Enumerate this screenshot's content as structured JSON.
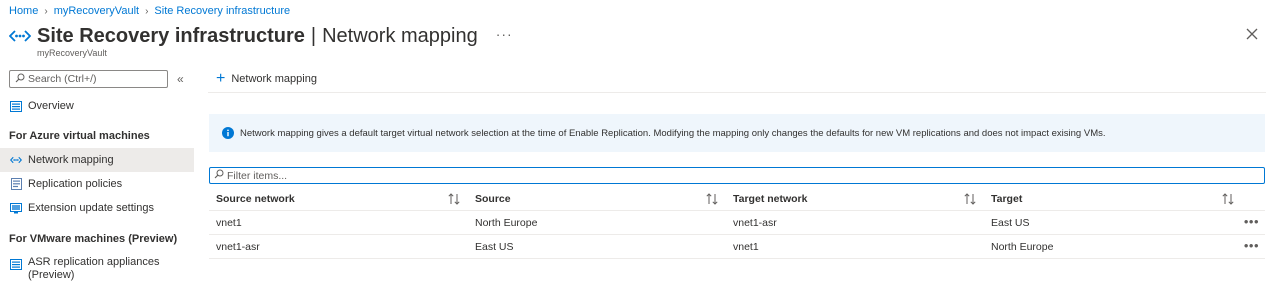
{
  "breadcrumb": {
    "items": [
      "Home",
      "myRecoveryVault",
      "Site Recovery infrastructure"
    ]
  },
  "header": {
    "title_main": "Site Recovery infrastructure",
    "title_separator": "|",
    "title_sub": "Network mapping",
    "more": "···",
    "resource": "myRecoveryVault"
  },
  "sidebar": {
    "search_placeholder": "Search (Ctrl+/)",
    "collapse": "«",
    "overview": "Overview",
    "section_azure": "For Azure virtual machines",
    "azure_items": [
      "Network mapping",
      "Replication policies",
      "Extension update settings"
    ],
    "section_vmware": "For VMware machines (Preview)",
    "vmware_items": [
      {
        "line1": "ASR replication appliances",
        "line2": "(Preview)"
      }
    ]
  },
  "toolbar": {
    "add_label": "Network mapping"
  },
  "info": {
    "text": "Network mapping gives a default target virtual network selection at the time of Enable Replication. Modifying the mapping only changes the defaults for new VM replications and does not impact exising VMs."
  },
  "filter": {
    "placeholder": "Filter items..."
  },
  "table": {
    "columns": [
      "Source network",
      "Source",
      "Target network",
      "Target"
    ],
    "rows": [
      [
        "vnet1",
        "North Europe",
        "vnet1-asr",
        "East US"
      ],
      [
        "vnet1-asr",
        "East US",
        "vnet1",
        "North Europe"
      ]
    ],
    "row_more": "•••"
  },
  "colors": {
    "accent": "#0078d4",
    "info_bg": "#eff6fc",
    "active_nav": "#edebe9"
  }
}
